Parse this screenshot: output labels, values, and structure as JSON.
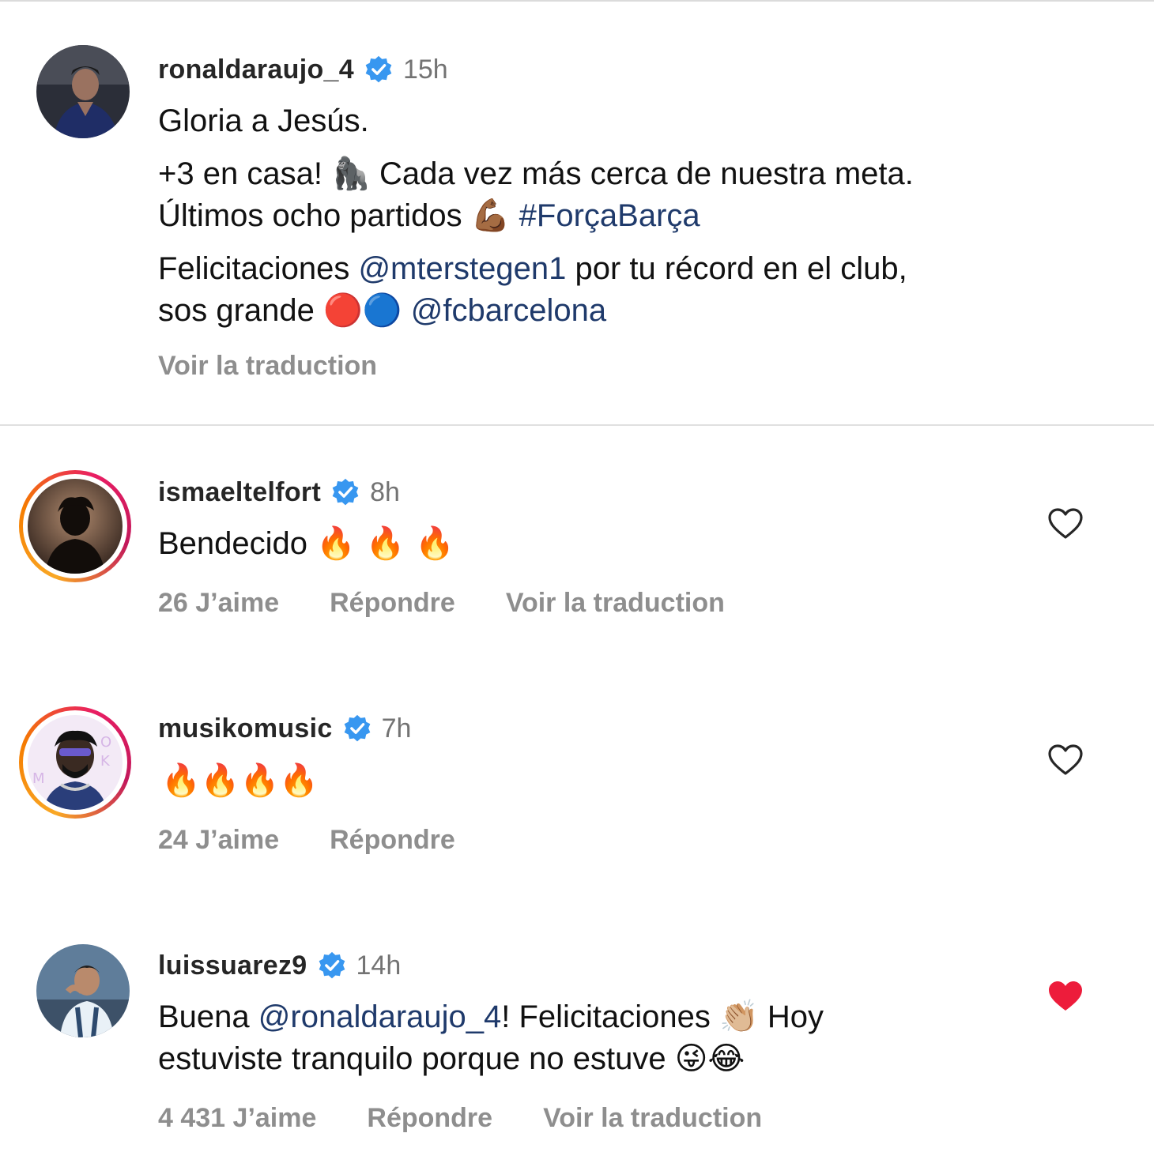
{
  "post": {
    "username": "ronaldaraujo_4",
    "time": "15h",
    "line1": "Gloria a Jesús.",
    "line2a": "+3 en casa! ",
    "line2_emoji": "🦍",
    "line2b": " Cada vez más cerca de nuestra meta.",
    "line3a": "Últimos ocho partidos ",
    "line3_emoji": "💪🏾",
    "line3_hashtag": " #ForçaBarça",
    "line4a": "Felicitaciones ",
    "line4_mention": "@mterstegen1",
    "line4b": " por tu récord en el club,",
    "line5a": "sos grande ",
    "line5_emoji": "🔴🔵",
    "line5_mention": " @fcbarcelona",
    "see_translation": "Voir la traduction"
  },
  "comments": [
    {
      "username": "ismaeltelfort",
      "time": "8h",
      "text": "Bendecido ",
      "emoji": "🔥 🔥 🔥",
      "likes": "26 J’aime",
      "reply": "Répondre",
      "translate": "Voir la traduction",
      "liked": false
    },
    {
      "username": "musikomusic",
      "time": "7h",
      "emoji": "🔥🔥🔥🔥",
      "likes": "24 J’aime",
      "reply": "Répondre",
      "liked": false
    },
    {
      "username": "luissuarez9",
      "time": "14h",
      "text_a": "Buena ",
      "mention": "@ronaldaraujo_4",
      "text_b": "! Felicitaciones ",
      "emoji_a": "👏🏼",
      "text_c": " Hoy",
      "line2": "estuviste tranquilo porque no estuve ",
      "emoji_b": "😜😂",
      "likes": "4 431 J’aime",
      "reply": "Répondre",
      "translate": "Voir la traduction",
      "liked": true
    }
  ],
  "colors": {
    "verified": "#3897f0",
    "link": "#1f3a6b",
    "liked_heart": "#ed1c3b",
    "muted": "#8e8e8e"
  },
  "icons": {
    "verified": "verified-badge-icon",
    "heart_outline": "heart-outline-icon",
    "heart_filled": "heart-filled-icon"
  }
}
